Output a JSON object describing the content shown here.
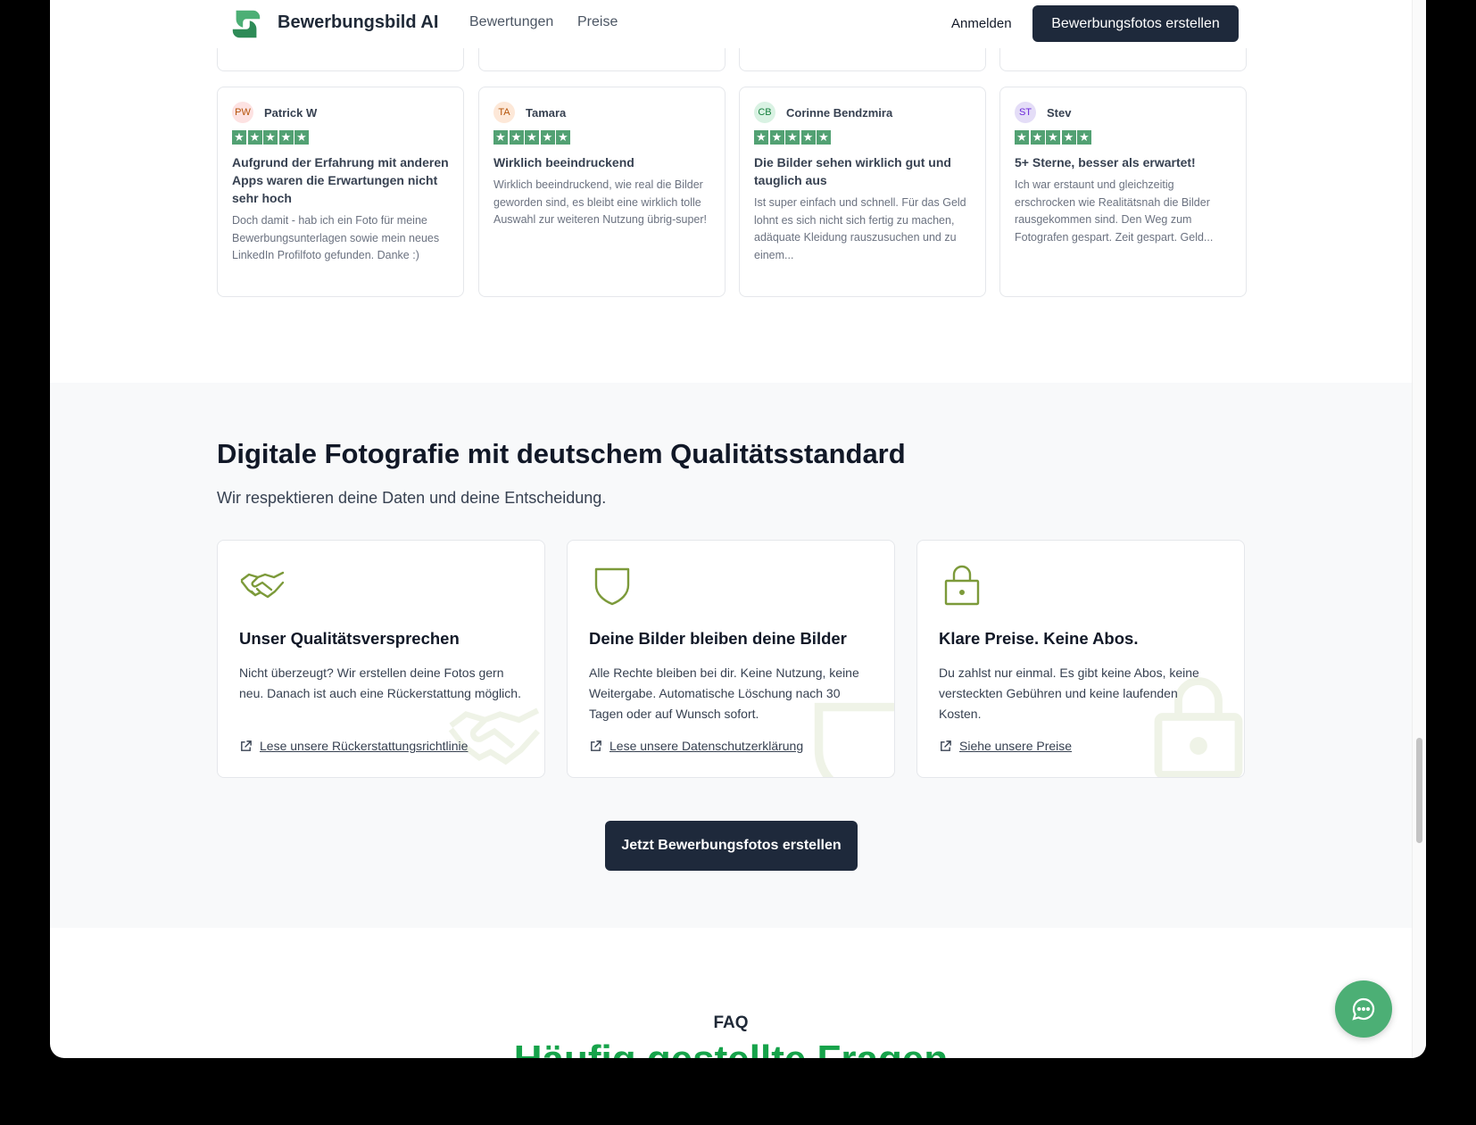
{
  "header": {
    "brand": "Bewerbungsbild AI",
    "nav": [
      "Bewertungen",
      "Preise"
    ],
    "login": "Anmelden",
    "cta": "Bewerbungsfotos erstellen"
  },
  "reviews": [
    {
      "initials": "PW",
      "name": "Patrick W",
      "title": "Aufgrund der Erfahrung mit anderen Apps waren die Erwartungen nicht sehr hoch",
      "text": "Doch damit - hab ich ein Foto für meine Bewerbungsunterlagen sowie mein neues LinkedIn Profilfoto gefunden. Danke :)"
    },
    {
      "initials": "TA",
      "name": "Tamara",
      "title": "Wirklich beeindruckend",
      "text": "Wirklich beeindruckend, wie real die Bilder geworden sind, es bleibt eine wirklich tolle Auswahl zur weiteren Nutzung übrig-super!"
    },
    {
      "initials": "CB",
      "name": "Corinne Bendzmira",
      "title": "Die Bilder sehen wirklich gut und tauglich aus",
      "text": "Ist super einfach und schnell. Für das Geld lohnt es sich nicht sich fertig zu machen, adäquate Kleidung rauszusuchen und zu einem..."
    },
    {
      "initials": "ST",
      "name": "Stev",
      "title": "5+ Sterne, besser als erwartet!",
      "text": "Ich war erstaunt und gleichzeitig erschrocken wie Realitätsnah die Bilder rausgekommen sind. Den Weg zum Fotografen gespart. Zeit gespart. Geld..."
    }
  ],
  "quality": {
    "title": "Digitale Fotografie mit deutschem Qualitätsstandard",
    "subtitle": "Wir respektieren deine Daten und deine Entscheidung.",
    "features": [
      {
        "icon": "handshake-icon",
        "title": "Unser Qualitätsversprechen",
        "text": "Nicht überzeugt? Wir erstellen deine Fotos gern neu. Danach ist auch eine Rückerstattung möglich.",
        "link": "Lese unsere Rückerstattungsrichtlinie"
      },
      {
        "icon": "shield-icon",
        "title": "Deine Bilder bleiben deine Bilder",
        "text": "Alle Rechte bleiben bei dir. Keine Nutzung, keine Weitergabe. Automatische Löschung nach 30 Tagen oder auf Wunsch sofort.",
        "link": "Lese unsere Datenschutzerklärung"
      },
      {
        "icon": "lock-icon",
        "title": "Klare Preise. Keine Abos.",
        "text": "Du zahlst nur einmal. Es gibt keine Abos, keine versteckten Gebühren und keine laufenden Kosten.",
        "link": "Siehe unsere Preise"
      }
    ],
    "cta": "Jetzt Bewerbungsfotos erstellen"
  },
  "faq": {
    "label": "FAQ",
    "title": "Häufig gestellte Fragen"
  },
  "colors": {
    "accent": "#16a34a",
    "dark": "#1e293b",
    "star": "#52a173",
    "icon": "#7c9a3a"
  }
}
